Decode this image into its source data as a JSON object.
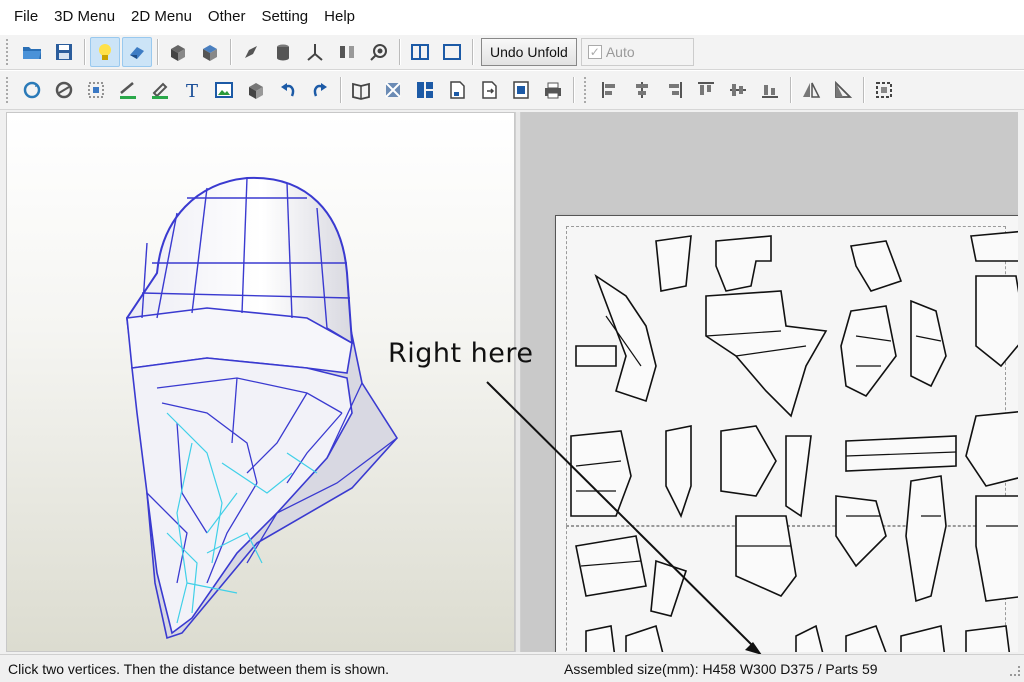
{
  "menu": [
    "File",
    "3D Menu",
    "2D Menu",
    "Other",
    "Setting",
    "Help"
  ],
  "toolbar1": {
    "icons": [
      "open-folder-icon",
      "save-icon",
      "lightbulb-icon",
      "texture-icon",
      "fold-icon",
      "unfold-icon",
      "pen-icon",
      "cylinder-icon",
      "axis-icon",
      "split-icon",
      "eye-icon",
      "single-pane-icon",
      "dual-pane-icon"
    ],
    "undo_unfold_label": "Undo Unfold",
    "auto_label": "Auto",
    "auto_checked": true
  },
  "toolbar2": {
    "icons": [
      "rotate-icon",
      "join-icon",
      "scale-icon",
      "line-icon",
      "edit-icon",
      "text-icon",
      "image-icon",
      "box-icon",
      "undo-icon",
      "redo-icon",
      "book-icon",
      "select-icon",
      "grid-icon",
      "page-icon",
      "export-icon",
      "page-settings-icon",
      "print-icon",
      "align-left-icon",
      "align-center-icon",
      "align-right-icon",
      "align-top-icon",
      "align-middle-icon",
      "align-bottom-icon",
      "flip-icon",
      "mirror-icon",
      "frame-icon"
    ]
  },
  "statusbar": {
    "hint": "Click two vertices. Then the distance between them is shown.",
    "assembled": "Assembled size(mm): H458 W300 D375 / Parts 59"
  },
  "annotation": {
    "text": "Right here"
  },
  "colors": {
    "mesh_edge": "#3a3ad0",
    "mesh_inner": "#40d0e8",
    "active_button": "#cce4f7"
  }
}
